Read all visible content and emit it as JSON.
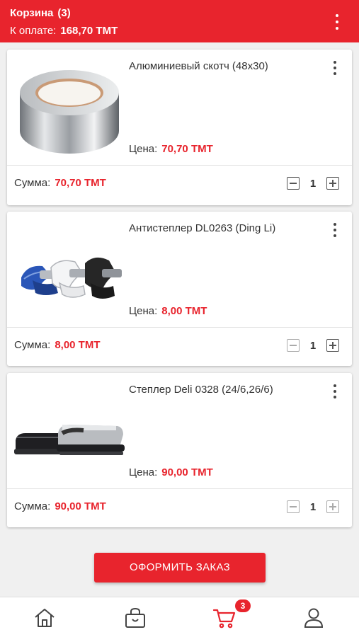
{
  "header": {
    "title": "Корзина",
    "count": "(3)",
    "pay_label": "К оплате:",
    "pay_amount": "168,70 ТМТ",
    "menu_icon": "more-vertical-icon"
  },
  "items": [
    {
      "name": "Алюминиевый скотч (48х30)",
      "price_label": "Цена:",
      "price": "70,70 ТМТ",
      "sum_label": "Сумма:",
      "sum": "70,70 ТМТ",
      "qty": "1",
      "image": "aluminum-tape-image"
    },
    {
      "name": "Антистеплер DL0263 (Ding Li)",
      "price_label": "Цена:",
      "price": "8,00 ТМТ",
      "sum_label": "Сумма:",
      "sum": "8,00 ТМТ",
      "qty": "1",
      "image": "staple-remover-image"
    },
    {
      "name": "Степлер Deli 0328 (24/6,26/6)",
      "price_label": "Цена:",
      "price": "90,00 ТМТ",
      "sum_label": "Сумма:",
      "sum": "90,00 ТМТ",
      "qty": "1",
      "image": "stapler-image"
    }
  ],
  "order_button": "ОФОРМИТЬ ЗАКАЗ",
  "bottom_nav": {
    "items": [
      "home-icon",
      "catalog-bag-icon",
      "cart-icon",
      "profile-icon"
    ],
    "cart_badge": "3"
  },
  "colors": {
    "accent": "#e8242d"
  }
}
